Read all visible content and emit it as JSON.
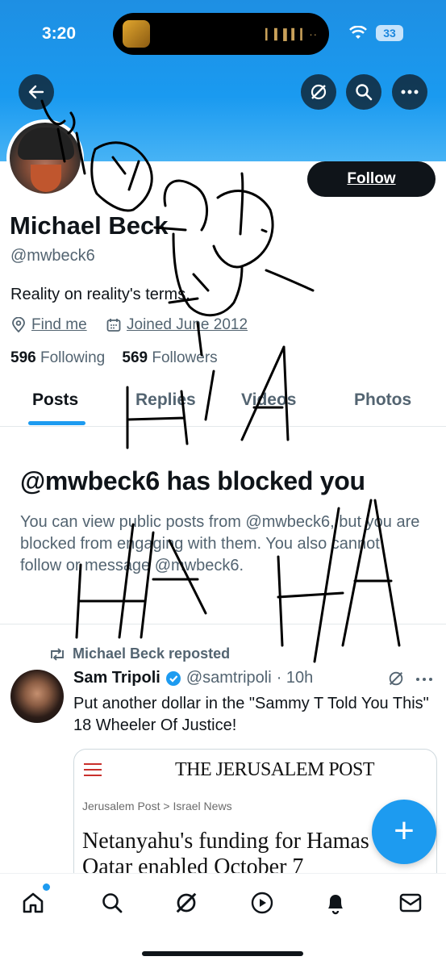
{
  "status_bar": {
    "time": "3:20",
    "battery": "33"
  },
  "header": {
    "back_icon": "arrow-left-icon",
    "grok_icon": "grok-icon",
    "search_icon": "search-icon",
    "more_icon": "more-icon"
  },
  "profile": {
    "name": "Michael Beck",
    "handle": "@mwbeck6",
    "bio": "Reality on reality's terms.",
    "location": "Find me",
    "joined": "Joined June 2012",
    "following_count": "596",
    "following_label": "Following",
    "followers_count": "569",
    "followers_label": "Followers",
    "follow_label": "Follow"
  },
  "tabs": [
    "Posts",
    "Replies",
    "Videos",
    "Photos"
  ],
  "blocked": {
    "title": "@mwbeck6 has blocked you",
    "description": "You can view public posts from @mwbeck6, but you are blocked from engaging with them. You also cannot follow or message @mwbeck6."
  },
  "post": {
    "repost_label": "Michael Beck reposted",
    "author_name": "Sam Tripoli",
    "author_handle": "@samtripoli",
    "time": "· 10h",
    "text": "Put another dollar in the \"Sammy T Told You This\" 18 Wheeler Of Justice!",
    "card": {
      "publication": "THE JERUSALEM POST",
      "breadcrumb": "Jerusalem Post > Israel News",
      "headline": "Netanyahu's funding for Hamas via Qatar enabled October 7"
    }
  },
  "fab_label": "+",
  "bottom_nav": [
    "home-icon",
    "search-icon",
    "grok-icon",
    "video-icon",
    "notifications-icon",
    "messages-icon"
  ],
  "colors": {
    "accent": "#1d9bf0",
    "banner": "#1a9af0",
    "text": "#0f1419",
    "muted": "#536471",
    "verified": "#1d9bf0"
  }
}
